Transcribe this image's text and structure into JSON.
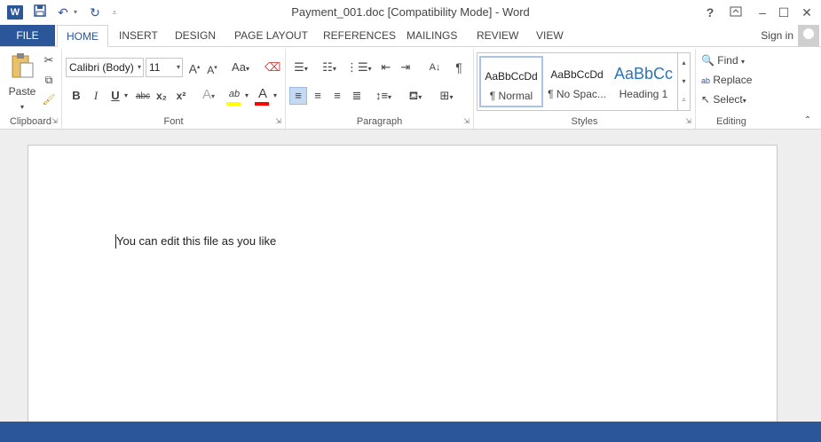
{
  "window": {
    "title": "Payment_001.doc [Compatibility Mode] - Word",
    "app_logo": "W",
    "help": "?",
    "controls": {
      "help": "?",
      "ribbon_display": "⧉",
      "minimize": "–",
      "maximize": "☐",
      "close": "✕"
    }
  },
  "quick_access": {
    "save": "save-icon",
    "undo": "undo-icon",
    "redo": "redo-icon",
    "customize": "customize-icon"
  },
  "tabs": {
    "file": "FILE",
    "items": [
      "HOME",
      "INSERT",
      "DESIGN",
      "PAGE LAYOUT",
      "REFERENCES",
      "MAILINGS",
      "REVIEW",
      "VIEW"
    ],
    "active": "HOME",
    "sign_in": "Sign in"
  },
  "ribbon": {
    "clipboard": {
      "label": "Clipboard",
      "paste": "Paste"
    },
    "font": {
      "label": "Font",
      "font_name": "Calibri (Body)",
      "font_size": "11",
      "grow": "A",
      "shrink": "A",
      "change_case": "Aa",
      "bold": "B",
      "italic": "I",
      "underline": "U",
      "strike": "abc",
      "subscript": "x₂",
      "superscript": "x²",
      "text_effects": "A",
      "highlight": "ab",
      "font_color": "A"
    },
    "paragraph": {
      "label": "Paragraph",
      "sort": "A↓",
      "pilcrow": "¶"
    },
    "styles": {
      "label": "Styles",
      "items": [
        {
          "sample": "AaBbCcDd",
          "name": "¶ Normal"
        },
        {
          "sample": "AaBbCcDd",
          "name": "¶ No Spac..."
        },
        {
          "sample": "AaBbCc",
          "name": "Heading 1"
        }
      ]
    },
    "editing": {
      "label": "Editing",
      "find": "Find",
      "replace": "Replace",
      "select": "Select"
    }
  },
  "document": {
    "text": "You can edit this file as you like"
  },
  "colors": {
    "accent": "#2b579a",
    "highlight": "#ffff00",
    "font_color": "#ff0000"
  }
}
